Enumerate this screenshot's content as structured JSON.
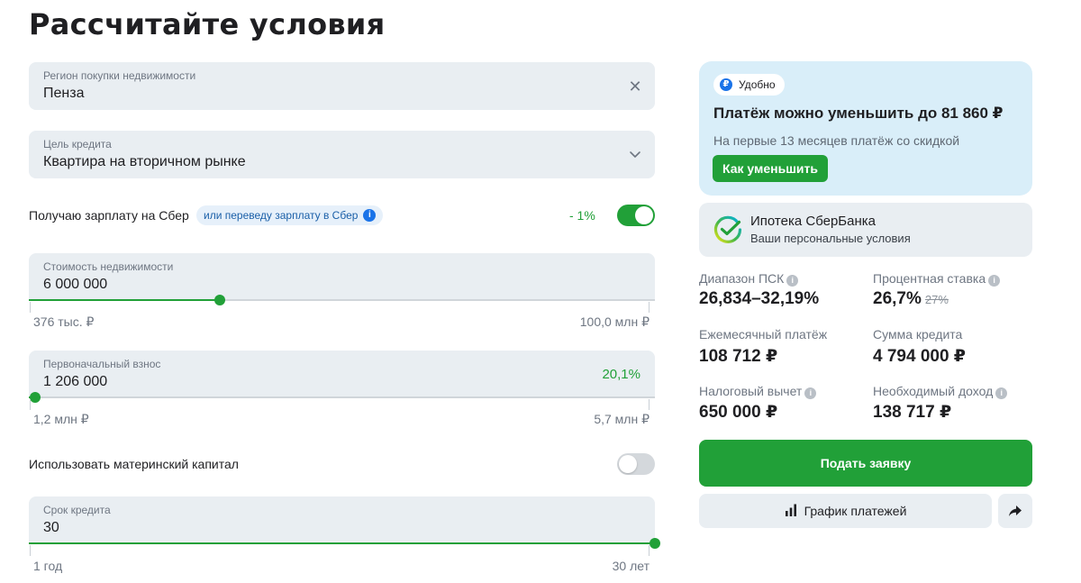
{
  "title": "Рассчитайте условия",
  "region": {
    "label": "Регион покупки недвижимости",
    "value": "Пенза"
  },
  "goal": {
    "label": "Цель кредита",
    "value": "Квартира на вторичном рынке"
  },
  "salary": {
    "label": "Получаю зарплату на Сбер",
    "chip": "или переведу зарплату в Сбер",
    "discount": "- 1%",
    "enabled": true
  },
  "price": {
    "label": "Стоимость недвижимости",
    "value": "6 000 000",
    "min_label": "376 тыс. ₽",
    "max_label": "100,0 млн ₽",
    "slider_fraction": 0.305
  },
  "down_payment": {
    "label": "Первоначальный взнос",
    "value": "1 206 000",
    "percent": "20,1%",
    "min_label": "1,2 млн ₽",
    "max_label": "5,7 млн ₽",
    "slider_fraction": 0.01
  },
  "maternity": {
    "label": "Использовать материнский капитал",
    "enabled": false
  },
  "term": {
    "label": "Срок кредита",
    "value": "30",
    "min_label": "1 год",
    "max_label": "30 лет",
    "slider_fraction": 1.0
  },
  "promo": {
    "badge": "Удобно",
    "title": "Платёж можно уменьшить до 81 860 ₽",
    "subtitle": "На первые 13 месяцев платёж со скидкой",
    "button": "Как уменьшить"
  },
  "sber_card": {
    "title": "Ипотека СберБанка",
    "subtitle": "Ваши персональные условия"
  },
  "stats": {
    "psk_label": "Диапазон ПСК",
    "psk_value": "26,834–32,19%",
    "rate_label": "Процентная ставка",
    "rate_value": "26,7%",
    "rate_old": "27%",
    "payment_label": "Ежемесячный платёж",
    "payment_value": "108 712 ₽",
    "loan_label": "Сумма кредита",
    "loan_value": "4 794 000 ₽",
    "tax_label": "Налоговый вычет",
    "tax_value": "650 000 ₽",
    "income_label": "Необходимый доход",
    "income_value": "138 717 ₽"
  },
  "actions": {
    "apply": "Подать заявку",
    "schedule": "График платежей"
  },
  "colors": {
    "accent": "#21a038",
    "field_bg": "#e9eef2",
    "promo_bg": "#d9eef9",
    "link": "#1a73e8"
  }
}
